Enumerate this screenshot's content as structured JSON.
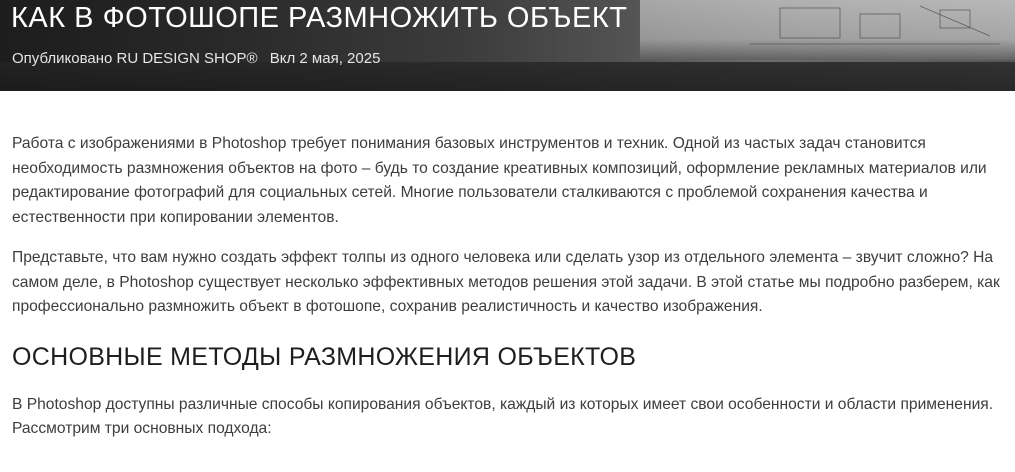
{
  "article": {
    "title": "КАК В ФОТОШОПЕ РАЗМНОЖИТЬ ОБЪЕКТ",
    "meta": {
      "published_by": "Опубликовано RU DESIGN SHOP®",
      "date": "Вкл 2 мая, 2025"
    },
    "paragraphs": [
      "Работа с изображениями в Photoshop требует понимания базовых инструментов и техник. Одной из частых задач становится необходимость размножения объектов на фото – будь то создание креативных композиций, оформление рекламных материалов или редактирование фотографий для социальных сетей. Многие пользователи сталкиваются с проблемой сохранения качества и естественности при копировании элементов.",
      "Представьте, что вам нужно создать эффект толпы из одного человека или сделать узор из отдельного элемента – звучит сложно? На самом деле, в Photoshop существует несколько эффективных методов решения этой задачи. В этой статье мы подробно разберем, как профессионально размножить объект в фотошопе, сохранив реалистичность и качество изображения.",
      "В Photoshop доступны различные способы копирования объектов, каждый из которых имеет свои особенности и области применения. Рассмотрим три основных подхода:"
    ],
    "section_heading": "ОСНОВНЫЕ МЕТОДЫ РАЗМНОЖЕНИЯ ОБЪЕКТОВ"
  }
}
